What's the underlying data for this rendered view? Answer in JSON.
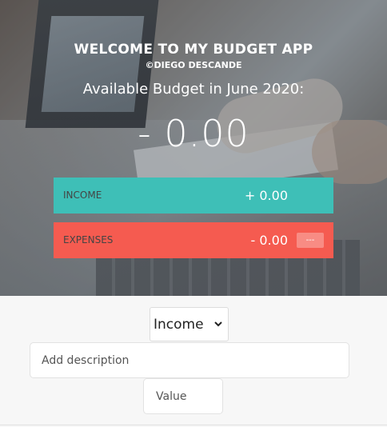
{
  "header": {
    "title": "WELCOME TO MY BUDGET APP",
    "subtitle": "©DIEGO DESCANDE",
    "budget_label": "Available Budget in June 2020:",
    "budget_value": "- 0.00"
  },
  "income": {
    "label": "INCOME",
    "value": "+ 0.00",
    "color": "#3ebfb7"
  },
  "expenses": {
    "label": "EXPENSES",
    "value": "- 0.00",
    "percentage": "---",
    "color": "#f55b50"
  },
  "add_form": {
    "type_selected": "Income",
    "description_placeholder": "Add description",
    "value_placeholder": "Value"
  },
  "icons": {
    "select_chevron": "chevron-down-icon"
  }
}
